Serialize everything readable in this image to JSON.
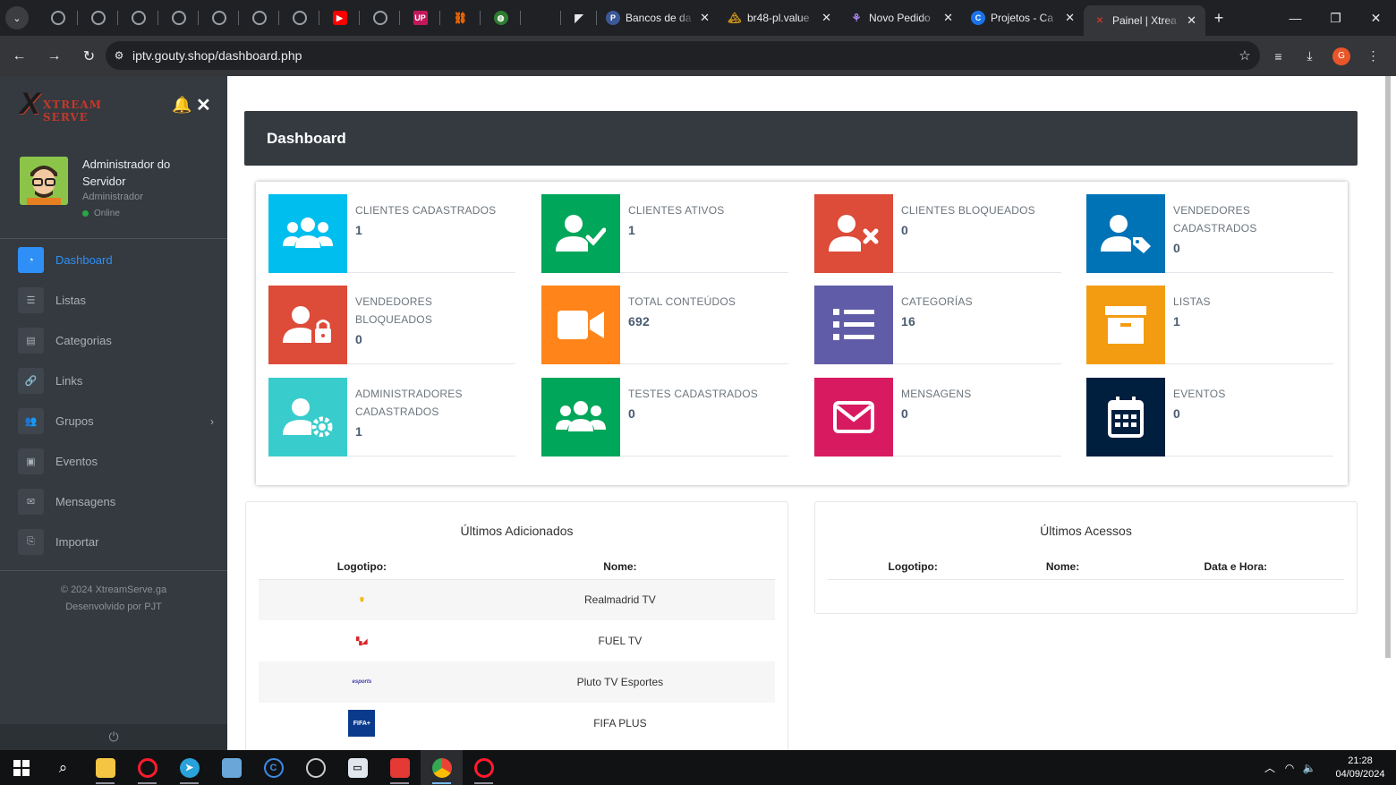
{
  "browser": {
    "tabs": [
      {
        "title": "Bancos de da",
        "favicon": "P",
        "color": "#3b5998"
      },
      {
        "title": "br48-pl.value",
        "favicon": "🏔",
        "color": "#d69a1c"
      },
      {
        "title": "Novo Pedido",
        "favicon": "⚘",
        "color": "#9b59b6"
      },
      {
        "title": "Projetos - Ca",
        "favicon": "C",
        "color": "#1a73e8"
      },
      {
        "title": "Painel | Xtrea",
        "favicon": "✕",
        "color": "#c0392b"
      }
    ],
    "url": "iptv.gouty.shop/dashboard.php",
    "profile_initial": "G"
  },
  "sidebar": {
    "brand": "XTREAM SERVE",
    "user_name": "Administrador do Servidor",
    "user_role": "Administrador",
    "user_status": "Online",
    "menu": [
      {
        "label": "Dashboard",
        "icon": "dashboard-icon",
        "glyph": "◔"
      },
      {
        "label": "Listas",
        "icon": "list-icon",
        "glyph": "☰"
      },
      {
        "label": "Categorias",
        "icon": "categories-icon",
        "glyph": "▤"
      },
      {
        "label": "Links",
        "icon": "link-icon",
        "glyph": "🔗"
      },
      {
        "label": "Grupos",
        "icon": "groups-icon",
        "glyph": "👥"
      },
      {
        "label": "Eventos",
        "icon": "events-icon",
        "glyph": "▣"
      },
      {
        "label": "Mensagens",
        "icon": "mail-icon",
        "glyph": "✉"
      },
      {
        "label": "Importar",
        "icon": "import-icon",
        "glyph": "⎘"
      }
    ],
    "footer_line1": "© 2024 XtreamServe.ga",
    "footer_line2": "Desenvolvido por PJT"
  },
  "dashboard": {
    "title": "Dashboard",
    "stats": [
      {
        "label": "CLIENTES CADASTRADOS",
        "value": "1",
        "color": "#00bfef",
        "icon": "users-icon"
      },
      {
        "label": "CLIENTES ATIVOS",
        "value": "1",
        "color": "#00a65a",
        "icon": "user-check-icon"
      },
      {
        "label": "CLIENTES BLOQUEADOS",
        "value": "0",
        "color": "#dd4b39",
        "icon": "user-x-icon"
      },
      {
        "label": "VENDEDORES CADASTRADOS",
        "value": "0",
        "color": "#0073b7",
        "icon": "user-tag-icon"
      },
      {
        "label": "VENDEDORES BLOQUEADOS",
        "value": "0",
        "color": "#dd4b39",
        "icon": "user-lock-icon"
      },
      {
        "label": "TOTAL CONTEÚDOS",
        "value": "692",
        "color": "#ff851b",
        "icon": "video-icon"
      },
      {
        "label": "CATEGORÍAS",
        "value": "16",
        "color": "#605ca8",
        "icon": "list-icon"
      },
      {
        "label": "LISTAS",
        "value": "1",
        "color": "#f39c12",
        "icon": "archive-icon"
      },
      {
        "label": "ADMINISTRADORES CADASTRADOS",
        "value": "1",
        "color": "#39cccc",
        "icon": "user-cog-icon"
      },
      {
        "label": "TESTES CADASTRADOS",
        "value": "0",
        "color": "#00a65a",
        "icon": "users-icon"
      },
      {
        "label": "MENSAGENS",
        "value": "0",
        "color": "#d81b60",
        "icon": "envelope-icon"
      },
      {
        "label": "EVENTOS",
        "value": "0",
        "color": "#001f3f",
        "icon": "calendar-icon"
      }
    ]
  },
  "recent_added": {
    "title": "Últimos Adicionados",
    "col_logo": "Logotipo:",
    "col_name": "Nome:",
    "rows": [
      {
        "name": "Realmadrid TV",
        "logo_text": "RM",
        "logo_color": "#f5b400"
      },
      {
        "name": "FUEL TV",
        "logo_text": "FUEL",
        "logo_color": "#d9242b"
      },
      {
        "name": "Pluto TV Esportes",
        "logo_text": "ESPORTES",
        "logo_color": "#3b3ba8"
      },
      {
        "name": "FIFA PLUS",
        "logo_text": "FIFA+",
        "logo_color": "#0a3a8c"
      }
    ]
  },
  "recent_access": {
    "title": "Últimos Acessos",
    "col_logo": "Logotipo:",
    "col_name": "Nome:",
    "col_datetime": "Data e Hora:"
  },
  "taskbar": {
    "time": "21:28",
    "date": "04/09/2024"
  }
}
